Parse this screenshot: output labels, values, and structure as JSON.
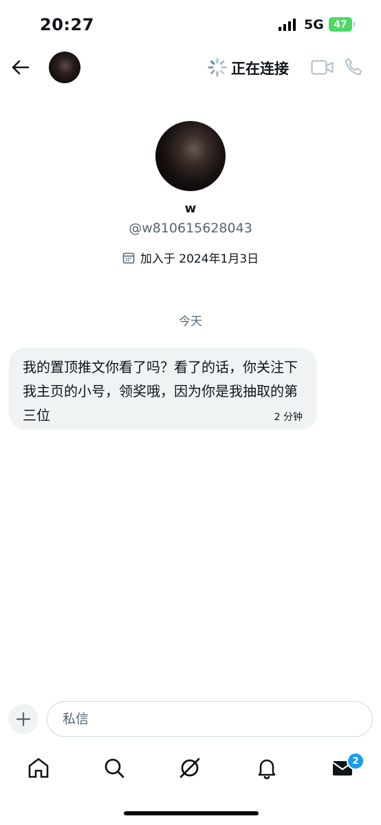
{
  "status_bar": {
    "time": "20:27",
    "network": "5G",
    "battery": "47"
  },
  "header": {
    "connection_status": "正在连接",
    "icons": [
      "back-arrow-icon",
      "loading-spinner-icon",
      "video-call-icon",
      "phone-call-icon"
    ]
  },
  "profile": {
    "display_name": "w",
    "handle": "@w810615628043",
    "joined": "加入于 2024年1月3日"
  },
  "conversation": {
    "day_label": "今天",
    "messages": [
      {
        "text": "我的置顶推文你看了吗？看了的话，你关注下我主页的小号，领奖哦，因为你是我抽取的第三位",
        "time": "2 分钟"
      }
    ]
  },
  "composer": {
    "placeholder": "私信"
  },
  "tab_bar": {
    "tabs": [
      "home-icon",
      "search-icon",
      "grok-icon",
      "notifications-icon",
      "messages-icon"
    ],
    "messages_badge": "2"
  },
  "colors": {
    "accent": "#1d9bf0",
    "bubble": "#eff3f4",
    "secondary_text": "#536471",
    "battery": "#4cd964"
  }
}
